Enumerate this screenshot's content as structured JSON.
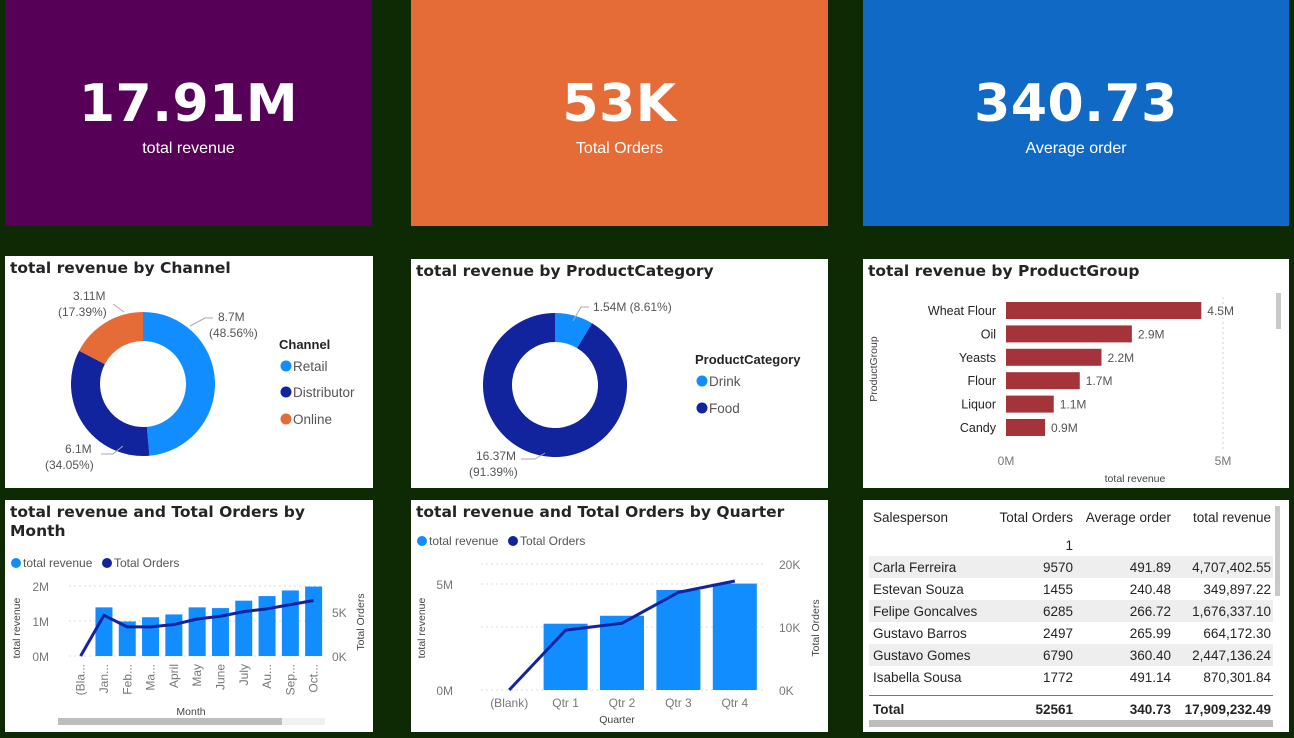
{
  "kpis": [
    {
      "value": "17.91M",
      "label": "total revenue",
      "color": "#560057"
    },
    {
      "value": "53K",
      "label": "Total Orders",
      "color": "#e66c37"
    },
    {
      "value": "340.73",
      "label": "Average order",
      "color": "#1069c4"
    }
  ],
  "colors": {
    "retail": "#118dff",
    "distributor": "#12239e",
    "online": "#e66c37",
    "bar_red": "#a4343a"
  },
  "channel_card": {
    "title": "total revenue by Channel",
    "legend_title": "Channel",
    "labels": {
      "retail": "8.7M",
      "retail_pct": "(48.56%)",
      "distributor": "6.1M",
      "distributor_pct": "(34.05%)",
      "online": "3.11M",
      "online_pct": "(17.39%)"
    }
  },
  "category_card": {
    "title": "total revenue by ProductCategory",
    "legend_title": "ProductCategory",
    "labels": {
      "drink": "1.54M (8.61%)",
      "food": "16.37M",
      "food_pct": "(91.39%)"
    }
  },
  "group_card": {
    "title": "total revenue by ProductGroup",
    "ylabel": "ProductGroup",
    "xlabel": "total revenue",
    "ticks": [
      "0M",
      "5M"
    ]
  },
  "month_card": {
    "title_line1": "total revenue and Total Orders by",
    "title_line2": "Month",
    "legend": [
      "total revenue",
      "Total Orders"
    ],
    "y_ticks": [
      "2M",
      "1M",
      "0M"
    ],
    "y2_ticks": [
      "5K",
      "0K"
    ],
    "ylabel": "total revenue",
    "y2label": "Total Orders",
    "xlabel": "Month"
  },
  "quarter_card": {
    "title": "total revenue and Total Orders by Quarter",
    "legend": [
      "total revenue",
      "Total Orders"
    ],
    "y_ticks": [
      "5M",
      "0M"
    ],
    "y2_ticks": [
      "20K",
      "10K",
      "0K"
    ],
    "ylabel": "total revenue",
    "y2label": "Total Orders",
    "xlabel": "Quarter"
  },
  "chart_data": [
    {
      "type": "pie",
      "title": "total revenue by Channel",
      "categories": [
        "Retail",
        "Distributor",
        "Online"
      ],
      "values": [
        8.7,
        6.1,
        3.11
      ],
      "percent": [
        48.56,
        34.05,
        17.39
      ],
      "legend_placement": "right"
    },
    {
      "type": "pie",
      "title": "total revenue by ProductCategory",
      "categories": [
        "Drink",
        "Food"
      ],
      "values": [
        1.54,
        16.37
      ],
      "percent": [
        8.61,
        91.39
      ],
      "legend_placement": "right"
    },
    {
      "type": "bar",
      "title": "total revenue by ProductGroup",
      "categories": [
        "Wheat Flour",
        "Oil",
        "Yeasts",
        "Flour",
        "Liquor",
        "Candy"
      ],
      "values": [
        4.5,
        2.9,
        2.2,
        1.7,
        1.1,
        0.9
      ],
      "data_labels": [
        "4.5M",
        "2.9M",
        "2.2M",
        "1.7M",
        "1.1M",
        "0.9M"
      ],
      "xlim": [
        0,
        5
      ],
      "xlabel": "total revenue",
      "ylabel": "ProductGroup"
    },
    {
      "type": "bar",
      "title": "total revenue and Total Orders by Month",
      "categories": [
        "(Bla...",
        "Jan...",
        "Feb...",
        "Ma...",
        "April",
        "May",
        "June",
        "July",
        "Au...",
        "Sep...",
        "Oct..."
      ],
      "series": [
        {
          "name": "total revenue",
          "type": "bar",
          "values": [
            0,
            1.38,
            0.98,
            1.1,
            1.18,
            1.38,
            1.36,
            1.57,
            1.7,
            1.86,
            1.97
          ]
        },
        {
          "name": "Total Orders",
          "type": "line",
          "values": [
            0,
            4400,
            3150,
            3150,
            3400,
            4000,
            4300,
            4800,
            5100,
            5550,
            6000
          ]
        }
      ],
      "ylim": [
        0,
        2.1
      ],
      "y2lim": [
        0,
        8000
      ],
      "legend_placement": "top-left"
    },
    {
      "type": "bar",
      "title": "total revenue and Total Orders by Quarter",
      "categories": [
        "(Blank)",
        "Qtr 1",
        "Qtr 2",
        "Qtr 3",
        "Qtr 4"
      ],
      "series": [
        {
          "name": "total revenue",
          "type": "bar",
          "values": [
            0,
            3.42,
            3.83,
            5.16,
            5.49
          ]
        },
        {
          "name": "Total Orders",
          "type": "line",
          "values": [
            0,
            9500,
            10600,
            15500,
            17300
          ]
        }
      ],
      "ylim": [
        0,
        6.5
      ],
      "y2lim": [
        0,
        20000
      ],
      "legend_placement": "top-left"
    },
    {
      "type": "table",
      "columns": [
        "Salesperson",
        "Total Orders",
        "Average order",
        "total revenue"
      ],
      "rows": [
        [
          "",
          "1",
          "",
          ""
        ],
        [
          "Carla Ferreira",
          "9570",
          "491.89",
          "4,707,402.55"
        ],
        [
          "Estevan Souza",
          "1455",
          "240.48",
          "349,897.22"
        ],
        [
          "Felipe Goncalves",
          "6285",
          "266.72",
          "1,676,337.10"
        ],
        [
          "Gustavo Barros",
          "2497",
          "265.99",
          "664,172.30"
        ],
        [
          "Gustavo Gomes",
          "6790",
          "360.40",
          "2,447,136.24"
        ],
        [
          "Isabella Sousa",
          "1772",
          "491.14",
          "870,301.84"
        ]
      ],
      "total": [
        "Total",
        "52561",
        "340.73",
        "17,909,232.49"
      ]
    }
  ]
}
